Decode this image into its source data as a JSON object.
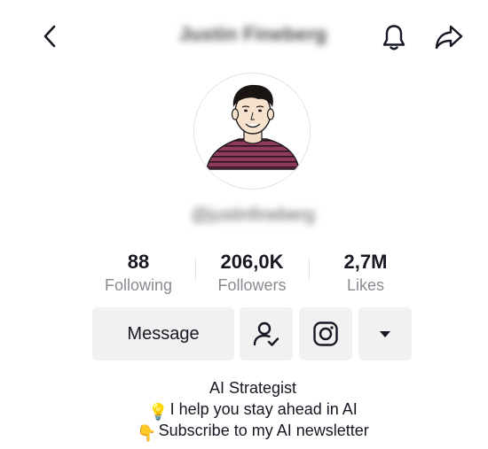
{
  "header": {
    "title": "Justin Fineberg",
    "icons": {
      "back": "chevron-left-icon",
      "notifications": "bell-icon",
      "share": "share-arrow-icon"
    }
  },
  "profile": {
    "handle": "@justinfineberg",
    "avatar": "cartoon-avatar-image"
  },
  "stats": {
    "following_count": "88",
    "following_label": "Following",
    "followers_count": "206,0K",
    "followers_label": "Followers",
    "likes_count": "2,7M",
    "likes_label": "Likes"
  },
  "actions": {
    "message_label": "Message",
    "icons": {
      "follow": "person-check-icon",
      "instagram": "instagram-icon",
      "more": "caret-down-icon"
    },
    "button_bg": "#f1f1f2"
  },
  "bio": {
    "line1": "AI Strategist",
    "line2_emoji": "💡",
    "line2_text": "I help you stay ahead in AI",
    "line3_emoji": "👇",
    "line3_text": "Subscribe to my AI newsletter"
  },
  "colors": {
    "text": "#161823",
    "muted": "#8a8b91",
    "avatar_shirt": "#8e3a5c"
  }
}
